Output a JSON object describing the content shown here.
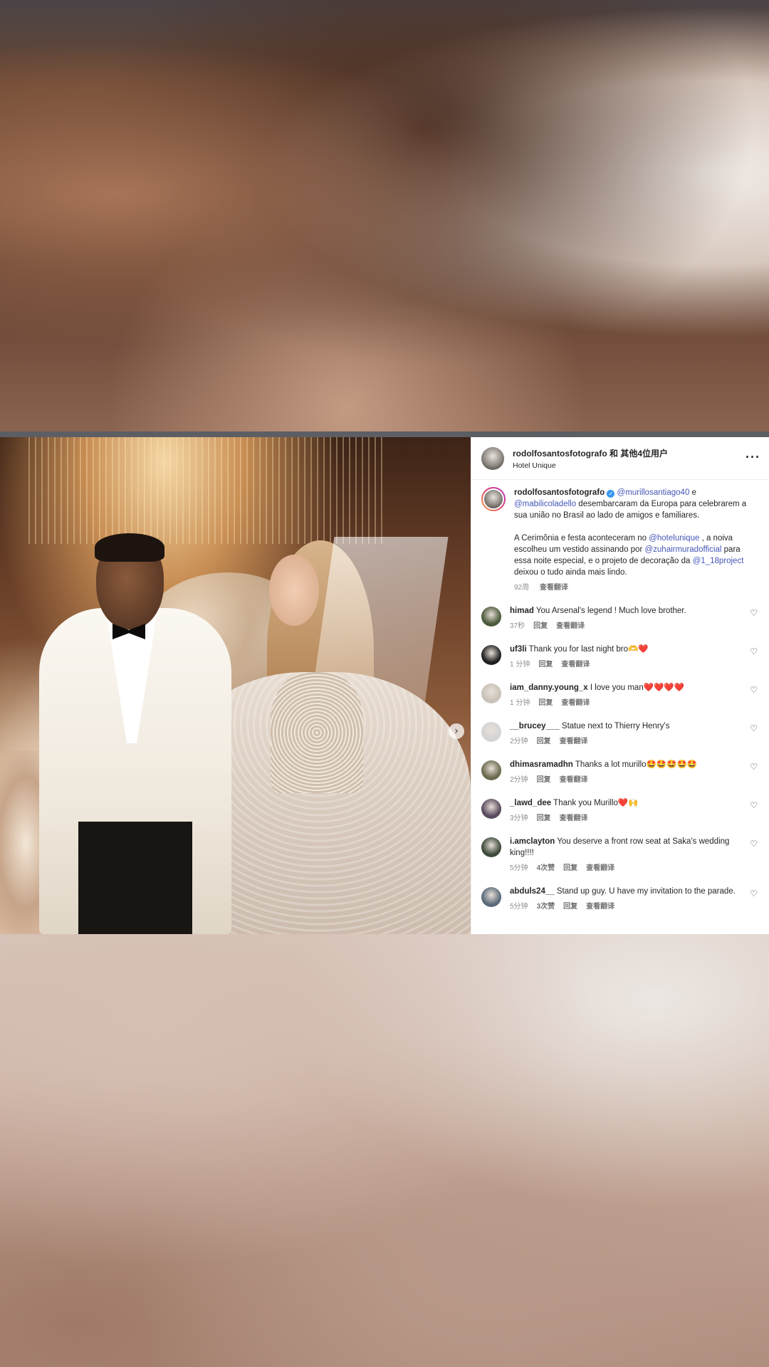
{
  "post": {
    "header": {
      "username": "rodolfosantosfotografo 和 其他4位用户",
      "location": "Hotel Unique",
      "more_label": "···"
    },
    "carousel_next": "›",
    "caption": {
      "username": "rodolfosantosfotografo",
      "verified_mark": "✓",
      "mention1": "@murillosantiago40",
      "text1": " e ",
      "mention2": "@mabilicoladello",
      "text2": " desembarcaram da Europa para celebrarem a sua união no Brasil ao lado de amigos e familiares.",
      "text3": "A Cerimônia e festa aconteceram no ",
      "mention3": "@hotelunique",
      "text4": " , a noiva escolheu um vestido assinando por ",
      "mention4": "@zuhairmuradofficial",
      "text5": " para essa noite especial, e o projeto de decoração da ",
      "mention5": "@1_18project",
      "text6": " deixou o tudo ainda mais lindo.",
      "time": "92周",
      "translate": "查看翻译"
    },
    "heart_icon": "♡",
    "reply_label": "回复",
    "translate_label": "查看翻译",
    "comments": [
      {
        "user": "himad",
        "text": "You Arsenal's legend ! Much love brother.",
        "time": "37秒",
        "likes": ""
      },
      {
        "user": "uf3li",
        "text": "Thank you for last night bro🫶❤️",
        "time": "1 分钟",
        "likes": ""
      },
      {
        "user": "iam_danny.young_x",
        "text": "I love you man❤️❤️❤️❤️",
        "time": "1 分钟",
        "likes": ""
      },
      {
        "user": "__brucey___",
        "text": "Statue next to Thierry Henry's",
        "time": "2分钟",
        "likes": ""
      },
      {
        "user": "dhimasramadhn",
        "text": "Thanks a lot murillo🤩🤩🤩🤩🤩",
        "time": "2分钟",
        "likes": ""
      },
      {
        "user": "_lawd_dee",
        "text": "Thank you Murillo❤️🙌",
        "time": "3分钟",
        "likes": ""
      },
      {
        "user": "i.amclayton",
        "text": "You deserve a front row seat at Saka's wedding king!!!!",
        "time": "5分钟",
        "likes": "4次赞"
      },
      {
        "user": "abduls24__",
        "text": "Stand up guy. U have my invitation to the parade.",
        "time": "5分钟",
        "likes": "3次赞"
      }
    ]
  },
  "colors": {
    "link": "#4556b7",
    "text": "#262626",
    "meta": "#8e8e8e"
  }
}
